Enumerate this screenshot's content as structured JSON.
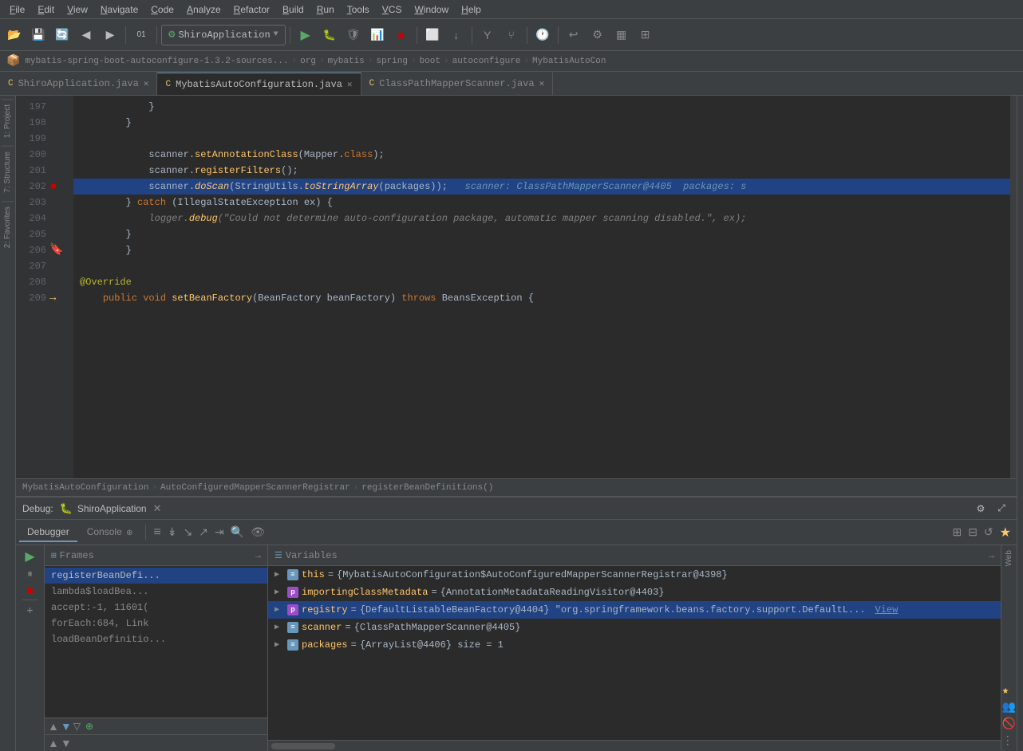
{
  "menu": {
    "items": [
      "File",
      "Edit",
      "View",
      "Navigate",
      "Code",
      "Analyze",
      "Refactor",
      "Build",
      "Run",
      "Tools",
      "VCS",
      "Window",
      "Help"
    ]
  },
  "breadcrumb_path": {
    "parts": [
      "mybatis-spring-boot-autoconfigure-1.3.2-sources...",
      "org",
      "mybatis",
      "spring",
      "boot",
      "autoconfigure",
      "MybatisAutoCon"
    ]
  },
  "tabs": [
    {
      "label": "ShiroApplication.java",
      "icon": "java",
      "active": false
    },
    {
      "label": "MybatisAutoConfiguration.java",
      "icon": "java",
      "active": true
    },
    {
      "label": "ClassPathMapperScanner.java",
      "icon": "java",
      "active": false
    }
  ],
  "code_lines": [
    {
      "num": "197",
      "gutter": "",
      "text": "            }"
    },
    {
      "num": "198",
      "gutter": "",
      "text": "        }"
    },
    {
      "num": "199",
      "gutter": "",
      "text": ""
    },
    {
      "num": "200",
      "gutter": "",
      "text": "            scanner.setAnnotationClass(Mapper.class);"
    },
    {
      "num": "201",
      "gutter": "",
      "text": "            scanner.registerFilters();"
    },
    {
      "num": "202",
      "gutter": "breakpoint",
      "text": "            scanner.doScan(StringUtils.toStringArray(packages));   scanner: ClassPathMapperScanner@4405  packages: s",
      "highlighted": true
    },
    {
      "num": "203",
      "gutter": "",
      "text": "        } catch (IllegalStateException ex) {"
    },
    {
      "num": "204",
      "gutter": "",
      "text": "            logger.debug(\"Could not determine auto-configuration package, automatic mapper scanning disabled.\", ex);"
    },
    {
      "num": "205",
      "gutter": "",
      "text": "        }"
    },
    {
      "num": "206",
      "gutter": "bookmark",
      "text": "        }"
    },
    {
      "num": "207",
      "gutter": "",
      "text": ""
    },
    {
      "num": "208",
      "gutter": "",
      "text": "    @Override"
    },
    {
      "num": "209",
      "gutter": "arrow",
      "text": "    public void setBeanFactory(BeanFactory beanFactory) throws BeansException {"
    }
  ],
  "editor_breadcrumb": {
    "parts": [
      "MybatisAutoConfiguration",
      "AutoConfiguredMapperScannerRegistrar",
      "registerBeanDefinitions()"
    ]
  },
  "debug": {
    "title": "Debug:",
    "app_name": "ShiroApplication",
    "tabs": [
      "Debugger",
      "Console"
    ],
    "frames_label": "Frames",
    "vars_label": "Variables",
    "frames": [
      {
        "label": "registerBeanDefi...",
        "active": true
      },
      {
        "label": "lambda$loadBea...",
        "active": false
      },
      {
        "label": "accept:-1, 11601(",
        "active": false
      },
      {
        "label": "forEach:684, Link",
        "active": false
      },
      {
        "label": "loadBeanDefinitio...",
        "active": false
      }
    ],
    "variables": [
      {
        "name": "this",
        "equals": " = ",
        "value": "{MybatisAutoConfiguration$AutoConfiguredMapperScannerRegistrar@4398}",
        "icon": "eq",
        "expand": true,
        "link": null
      },
      {
        "name": "importingClassMetadata",
        "equals": " = ",
        "value": "{AnnotationMetadataReadingVisitor@4403}",
        "icon": "p",
        "expand": true,
        "link": null
      },
      {
        "name": "registry",
        "equals": " = ",
        "value": "{DefaultListableBeanFactory@4404}  \"org.springframework.beans.factory.support.DefaultL...",
        "icon": "p",
        "expand": true,
        "link": "View"
      },
      {
        "name": "scanner",
        "equals": " = ",
        "value": "{ClassPathMapperScanner@4405}",
        "icon": "eq",
        "expand": true,
        "link": null
      },
      {
        "name": "packages",
        "equals": " = ",
        "value": "{ArrayList@4406}  size = 1",
        "icon": "eq",
        "expand": true,
        "link": null
      }
    ]
  },
  "run_config": "ShiroApplication"
}
